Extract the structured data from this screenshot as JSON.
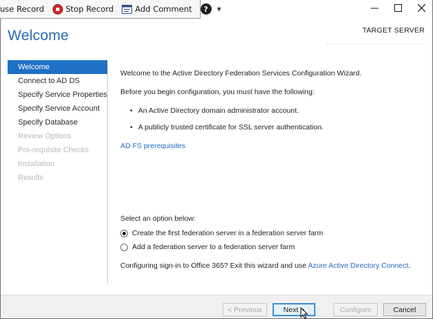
{
  "recorder": {
    "pause_label": "use Record",
    "stop_label": "Stop Record",
    "comment_label": "Add Comment",
    "help_label": "?"
  },
  "header": {
    "title": "Welcome",
    "target_server_label": "TARGET SERVER"
  },
  "nav": {
    "items": [
      {
        "label": "Welcome",
        "state": "active"
      },
      {
        "label": "Connect to AD DS",
        "state": "enabled"
      },
      {
        "label": "Specify Service Properties",
        "state": "enabled"
      },
      {
        "label": "Specify Service Account",
        "state": "enabled"
      },
      {
        "label": "Specify Database",
        "state": "enabled"
      },
      {
        "label": "Review Options",
        "state": "disabled"
      },
      {
        "label": "Pre-requisite Checks",
        "state": "disabled"
      },
      {
        "label": "Installation",
        "state": "disabled"
      },
      {
        "label": "Results",
        "state": "disabled"
      }
    ]
  },
  "content": {
    "intro": "Welcome to the Active Directory Federation Services Configuration Wizard.",
    "before_begin": "Before you begin configuration, you must have the following:",
    "requirements": [
      "An Active Directory domain administrator account.",
      "A publicly trusted certificate for SSL server authentication."
    ],
    "prereq_link": "AD FS prerequisites",
    "select_option": "Select an option below:",
    "options": [
      {
        "label": "Create the first federation server in a federation server farm",
        "selected": true
      },
      {
        "label": "Add a federation server to a federation server farm",
        "selected": false
      }
    ],
    "office_text": "Configuring sign-in to Office 365? Exit this wizard and use ",
    "office_link": "Azure Active Directory Connect",
    "office_end": "."
  },
  "buttons": {
    "previous": "< Previous",
    "next": "Next >",
    "configure": "Configure",
    "cancel": "Cancel"
  },
  "colors": {
    "accent": "#1f70c7",
    "title": "#2b6cb0",
    "link": "#1f66c0"
  }
}
